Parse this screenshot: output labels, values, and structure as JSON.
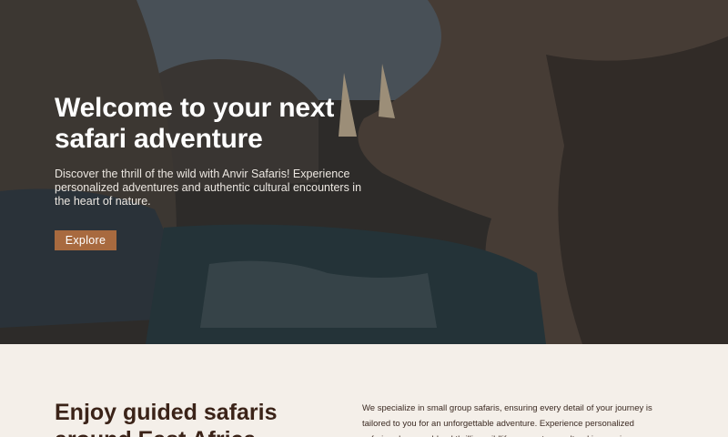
{
  "hero": {
    "title_line1": "Welcome to your next",
    "title_line2": "safari adventure",
    "subtitle": "Discover the thrill of the wild with Anvir Safaris! Experience personalized adventures and authentic cultural encounters in the heart of nature.",
    "cta_label": "Explore",
    "background_image": "hippos-in-water-photo"
  },
  "about": {
    "title": "Enjoy guided safaris around East Africa",
    "text": "We specialize in small group safaris, ensuring every detail of your journey is tailored to you for an unforgettable adventure. Experience personalized safaris, where we blend thrilling wildlife encounters, cultural immersions"
  },
  "colors": {
    "accent": "#a86a3f",
    "heading": "#3b2318",
    "section_bg": "#f4efe9"
  }
}
